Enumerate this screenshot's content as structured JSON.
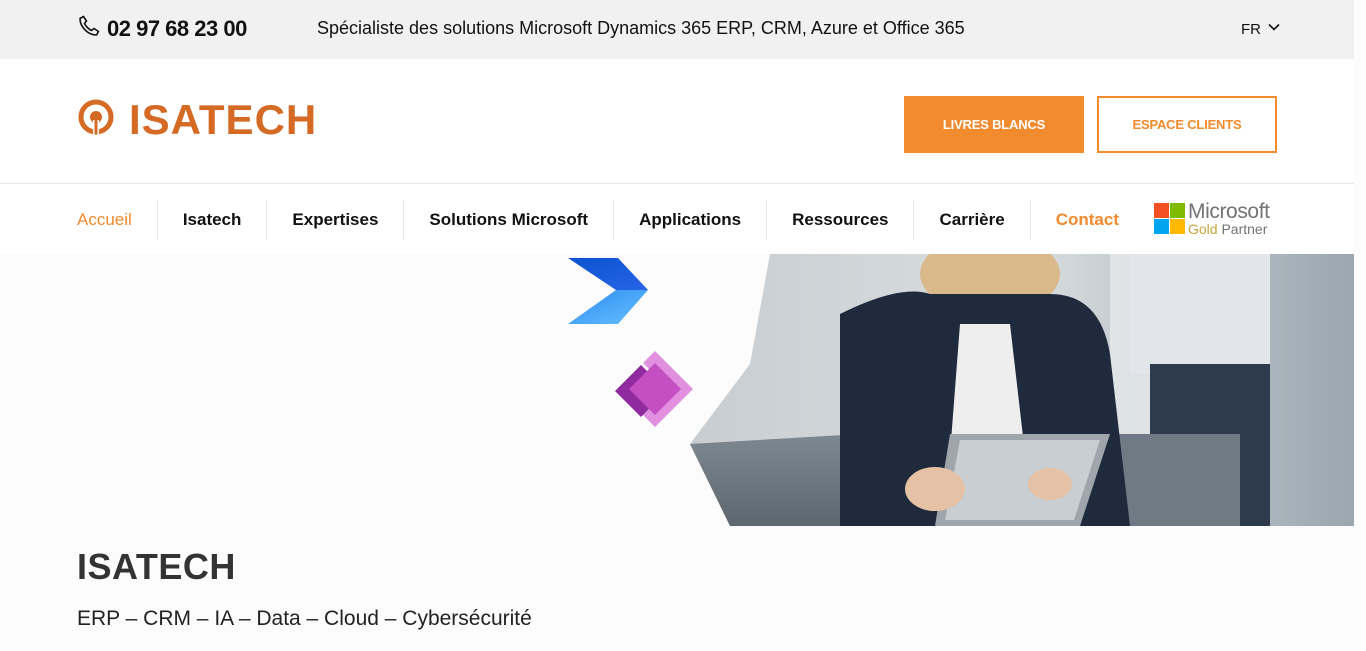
{
  "topbar": {
    "phone": "02 97 68 23 00",
    "tagline": "Spécialiste des solutions Microsoft Dynamics 365 ERP, CRM, Azure et Office 365",
    "language": "FR"
  },
  "header": {
    "logo_text": "ISATECH",
    "btn_primary": "LIVRES BLANCS",
    "btn_outline": "ESPACE CLIENTS"
  },
  "nav": {
    "items": [
      "Accueil",
      "Isatech",
      "Expertises",
      "Solutions Microsoft",
      "Applications",
      "Ressources",
      "Carrière",
      "Contact"
    ],
    "badge_top": "Microsoft",
    "badge_gold": "Gold",
    "badge_partner": "Partner"
  },
  "hero": {
    "title": "ISATECH",
    "subtitle": "ERP – CRM – IA – Data – Cloud – Cybersécurité"
  },
  "colors": {
    "accent": "#f28a2e",
    "logo": "#d56a24"
  }
}
